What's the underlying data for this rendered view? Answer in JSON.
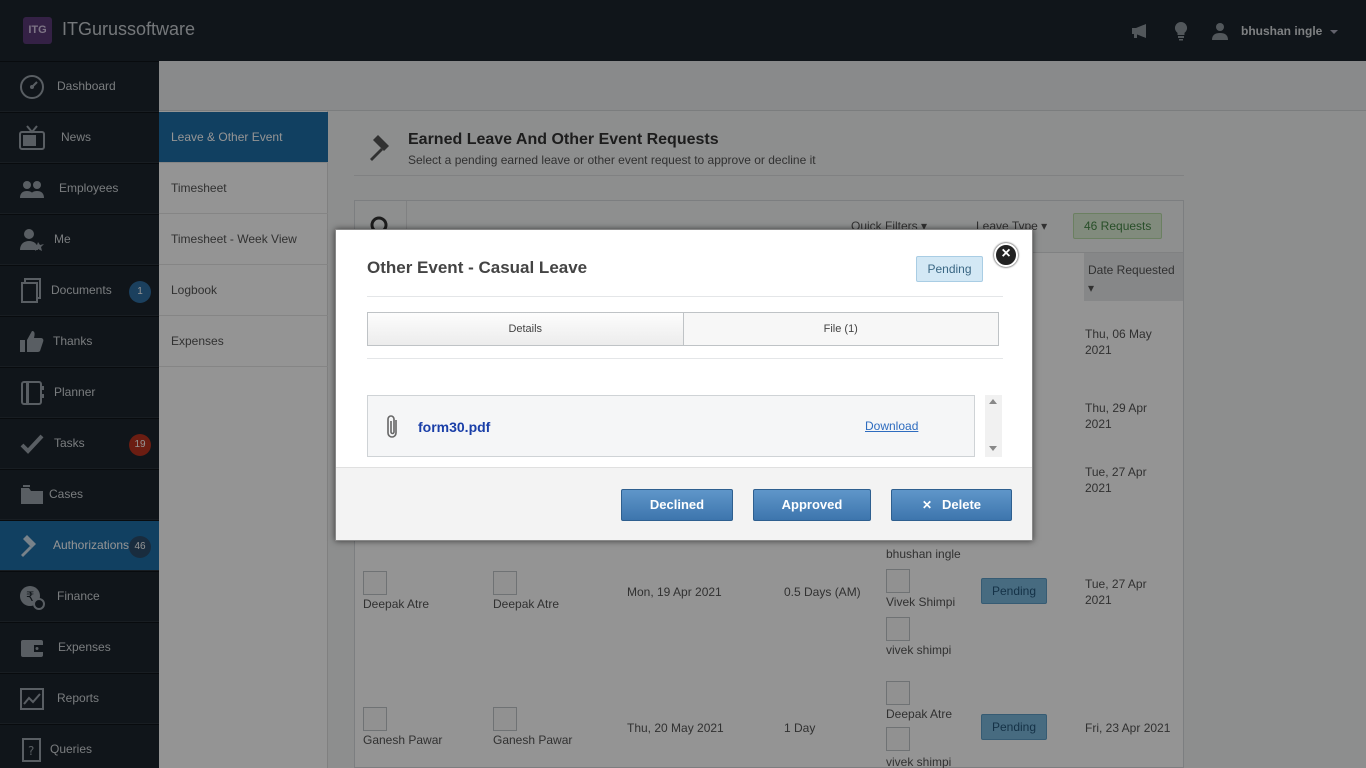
{
  "app": {
    "logo_text": "ITG",
    "brand": "ITGurussoftware",
    "user_name": "bhushan ingle"
  },
  "sidebar": {
    "items": [
      {
        "label": "Dashboard",
        "icon": "dashboard-icon"
      },
      {
        "label": "News",
        "icon": "tv-icon"
      },
      {
        "label": "Employees",
        "icon": "people-icon"
      },
      {
        "label": "Me",
        "icon": "person-icon"
      },
      {
        "label": "Documents",
        "icon": "documents-icon",
        "badge": "1"
      },
      {
        "label": "Thanks",
        "icon": "thumbs-up-icon"
      },
      {
        "label": "Planner",
        "icon": "planner-icon"
      },
      {
        "label": "Tasks",
        "icon": "checkmark-icon",
        "badge": "19"
      },
      {
        "label": "Cases",
        "icon": "folder-icon"
      },
      {
        "label": "Authorizations",
        "icon": "gavel-icon",
        "badge": "46",
        "active": true
      },
      {
        "label": "Finance",
        "icon": "rupee-icon"
      },
      {
        "label": "Expenses",
        "icon": "wallet-icon"
      },
      {
        "label": "Reports",
        "icon": "chart-icon"
      },
      {
        "label": "Queries",
        "icon": "question-icon"
      }
    ],
    "badge_colors": {
      "blue": "#2f6ea3",
      "red": "#b8321f",
      "dark": "#2b4d6b"
    }
  },
  "subnav": {
    "items": [
      {
        "label": "Leave & Other Event",
        "active": true
      },
      {
        "label": "Timesheet"
      },
      {
        "label": "Timesheet - Week View"
      },
      {
        "label": "Logbook"
      },
      {
        "label": "Expenses"
      }
    ]
  },
  "page": {
    "title": "Earned Leave And Other Event Requests",
    "subtitle": "Select a pending earned leave or other event request to approve or decline it",
    "quick_filters": "Quick Filters",
    "leave_type": "Leave Type",
    "requests_count": "46 Requests",
    "column_date_requested": "Date Requested"
  },
  "rows_visible": {
    "dates_requested": [
      "Thu, 06 May 2021",
      "Thu, 29 Apr 2021",
      "Tue, 27 Apr 2021"
    ],
    "row4": {
      "employee": "Deepak Atre",
      "requested_by": "Deepak Atre",
      "date": "Mon, 19 Apr 2021",
      "duration": "0.5 Days (AM)",
      "approvers": [
        "bhushan ingle",
        "Vivek Shimpi",
        "vivek shimpi"
      ],
      "status": "Pending",
      "date_requested": "Tue, 27 Apr 2021"
    },
    "row5": {
      "employee": "Ganesh Pawar",
      "requested_by": "Ganesh Pawar",
      "date": "Thu, 20 May 2021",
      "duration": "1 Day",
      "approvers": [
        "Deepak Atre",
        "vivek shimpi"
      ],
      "status": "Pending",
      "date_requested": "Fri, 23 Apr 2021"
    }
  },
  "modal": {
    "title": "Other Event - Casual Leave",
    "status": "Pending",
    "close": "×",
    "tabs": [
      "Details",
      "File (1)"
    ],
    "file": {
      "name": "form30.pdf",
      "action": "Download"
    },
    "buttons": {
      "declined": "Declined",
      "approved": "Approved",
      "delete": "Delete",
      "delete_icon": "✕"
    }
  }
}
